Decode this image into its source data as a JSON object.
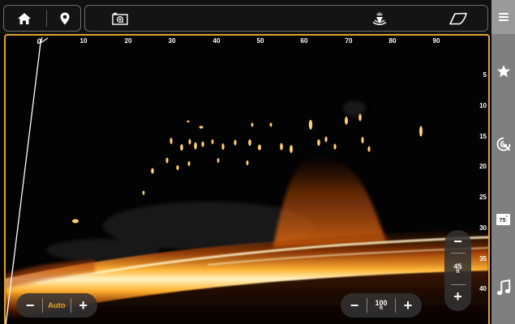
{
  "topbar": {
    "home_icon": "home-icon",
    "waypoint_icon": "map-pin-icon",
    "camera_icon": "camera-icon",
    "sonar_icon": "sonar-ping-icon",
    "chart_icon": "chart-outline-icon",
    "menu_icon": "hamburger-menu-icon"
  },
  "sonar": {
    "range_ticks": [
      "0",
      "10",
      "20",
      "30",
      "40",
      "50",
      "60",
      "70",
      "80",
      "90"
    ],
    "depth_ticks": [
      "5",
      "10",
      "15",
      "20",
      "25",
      "30",
      "35",
      "40"
    ],
    "accent_color": "#e0a230"
  },
  "sidebar": {
    "star_icon": "star-icon",
    "sonar_settings_icon": "sonar-settings-icon",
    "water_temp": "75",
    "temp_unit": "°",
    "music_icon": "music-note-icon"
  },
  "controls": {
    "gain": {
      "minus": "−",
      "value": "Auto",
      "plus": "+"
    },
    "range": {
      "minus": "−",
      "value": "100",
      "unit": "ft",
      "plus": "+"
    },
    "depth": {
      "minus": "−",
      "value": "45",
      "unit": "ft",
      "plus": "+"
    }
  }
}
